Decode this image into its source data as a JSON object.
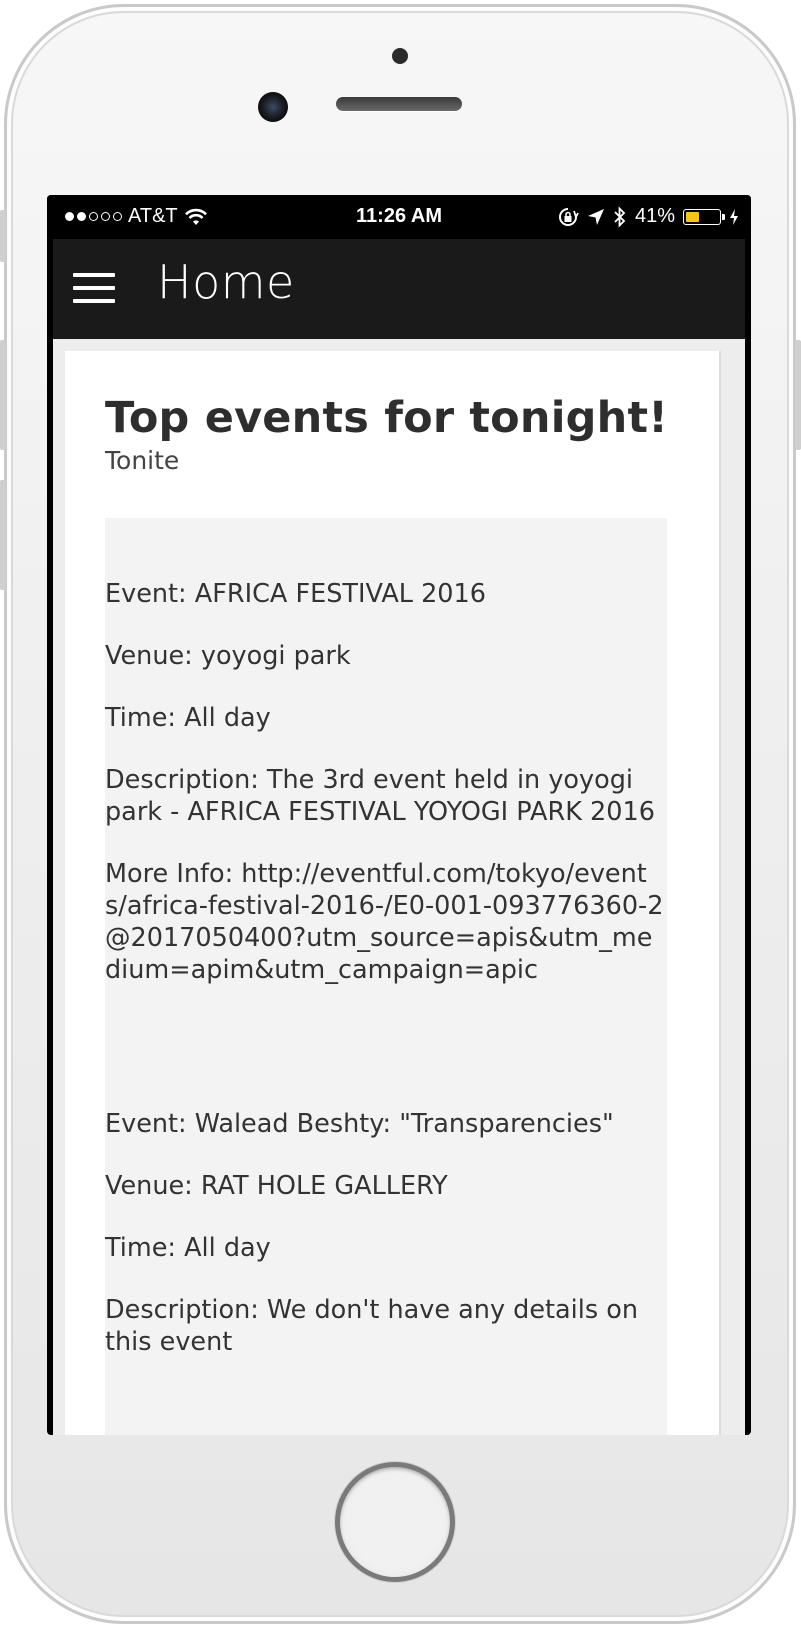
{
  "status_bar": {
    "carrier": "AT&T",
    "time": "11:26 AM",
    "battery_percent": "41%",
    "battery_level": 0.41
  },
  "header": {
    "title": "Home"
  },
  "card": {
    "title": "Top events for tonight!",
    "subtitle": "Tonite"
  },
  "events": [
    {
      "event": "Event: AFRICA FESTIVAL 2016",
      "venue": "Venue: yoyogi park",
      "time": "Time: All day",
      "description": "Description: The 3rd event held in yoyogi park - AFRICA FESTIVAL YOYOGI PARK 2016",
      "more_info": "More Info: http://eventful.com/tokyo/events/africa-festival-2016-/E0-001-093776360-2@2017050400?utm_source=apis&utm_medium=apim&utm_campaign=apic"
    },
    {
      "event": "Event: Walead Beshty: \"Transparencies\"",
      "venue": "Venue: RAT HOLE GALLERY",
      "time": "Time: All day",
      "description": "Description: We don't have any details on this event"
    }
  ]
}
